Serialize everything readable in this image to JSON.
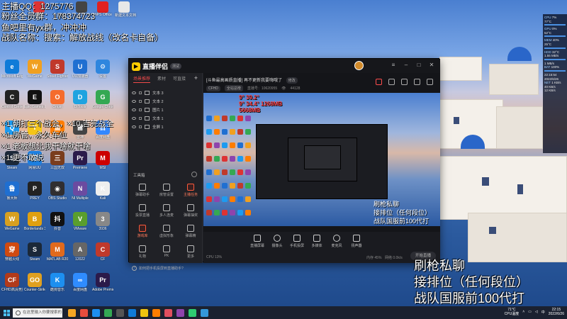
{
  "overlay_top": {
    "line1": "主播QQ：1275776",
    "line2": "粉丝全员群：178374723",
    "line3": "鱼吧里有yx群，冲冲冲",
    "line4": "战队名称：搜索：解放战线（改名卡自备）"
  },
  "overlay_mid": {
    "line1": "×1 朝打三个战会，×10 吉完战全",
    "line2": "×1 房管，永久车位",
    "line3": "×1 老板想让我干啥就干啥",
    "line4": "×1 更不敢说"
  },
  "overlay_bottom": {
    "line1": "刷枪私聊",
    "line2": "接排位（任何段位）",
    "line3": "战队国服前100代打"
  },
  "desktop_top_icons": [
    {
      "label": "网易云",
      "color": "#d33"
    },
    {
      "label": "迅雷",
      "color": "#3a7bd5"
    },
    {
      "label": "CF",
      "color": "#444"
    },
    {
      "label": "WPS Office",
      "color": "#e02020"
    },
    {
      "label": "新建文本文档",
      "color": "#e8e8e8"
    }
  ],
  "desktop_icons": [
    {
      "label": "Microsoft Edge",
      "glyph": "e",
      "color": "#0f7bd8"
    },
    {
      "label": "WeGame",
      "glyph": "W",
      "color": "#f0a020"
    },
    {
      "label": "Street Fighter",
      "glyph": "S",
      "color": "#c0392b"
    },
    {
      "label": "UU加速器",
      "glyph": "U",
      "color": "#1f6fd1"
    },
    {
      "label": "设置",
      "glyph": "⚙",
      "color": "#2e86de"
    },
    {
      "label": "Control Center 3.0",
      "glyph": "C",
      "color": "#222"
    },
    {
      "label": "Epic Games Launcher",
      "glyph": "E",
      "color": "#111"
    },
    {
      "label": "Origin",
      "glyph": "O",
      "color": "#f56c2d"
    },
    {
      "label": "DiTools",
      "glyph": "D",
      "color": "#1fa3e0"
    },
    {
      "label": "Google Chrome",
      "glyph": "G",
      "color": "#34a853"
    },
    {
      "label": "腾讯QQ",
      "glyph": "Q",
      "color": "#1d9bf0"
    },
    {
      "label": "YY语音",
      "glyph": "Y",
      "color": "#f5c518"
    },
    {
      "label": "斗鱼",
      "glyph": "鱼",
      "color": "#ff7d00"
    },
    {
      "label": "雷神",
      "glyph": "雷",
      "color": "#444"
    },
    {
      "label": "百度网盘",
      "glyph": "百",
      "color": "#3388ff"
    },
    {
      "label": "Steam",
      "glyph": "S",
      "color": "#1b2838"
    },
    {
      "label": "网易UU",
      "glyph": "网",
      "color": "#1c7fe0"
    },
    {
      "label": "三国无双",
      "glyph": "三",
      "color": "#7a3d1d"
    },
    {
      "label": "Premiere",
      "glyph": "Pr",
      "color": "#2b1a4a"
    },
    {
      "label": "MSI",
      "glyph": "M",
      "color": "#c00"
    },
    {
      "label": "鲁大师",
      "glyph": "鲁",
      "color": "#1f6fd1"
    },
    {
      "label": "PREY",
      "glyph": "P",
      "color": "#222"
    },
    {
      "label": "OBS Studio",
      "glyph": "◉",
      "color": "#302e31"
    },
    {
      "label": "NI Multiple",
      "glyph": "N",
      "color": "#6b4ba0"
    },
    {
      "label": "Kali",
      "glyph": "K",
      "color": "#eee"
    },
    {
      "label": "WeGame",
      "glyph": "W",
      "color": "#d8a020"
    },
    {
      "label": "Borderlands 3",
      "glyph": "B",
      "color": "#e0a010"
    },
    {
      "label": "抖音",
      "glyph": "抖",
      "color": "#111"
    },
    {
      "label": "VMware",
      "glyph": "V",
      "color": "#5a9e2d"
    },
    {
      "label": "3936",
      "glyph": "3",
      "color": "#888"
    },
    {
      "label": "穿越火线",
      "glyph": "穿",
      "color": "#d04a10"
    },
    {
      "label": "Steam",
      "glyph": "S",
      "color": "#1b2838"
    },
    {
      "label": "MATLAB R2022a",
      "glyph": "M",
      "color": "#e06a1d"
    },
    {
      "label": "12022",
      "glyph": "A",
      "color": "#666"
    },
    {
      "label": "CF",
      "glyph": "C",
      "color": "#c0392b"
    },
    {
      "label": "CFHD高清竞技大区",
      "glyph": "CF",
      "color": "#b23a1a"
    },
    {
      "label": "Counter-Strike Global Off",
      "glyph": "GO",
      "color": "#e0a020"
    },
    {
      "label": "酷狗音乐",
      "glyph": "K",
      "color": "#1d8ff0"
    },
    {
      "label": "百度网盘",
      "glyph": "∞",
      "color": "#2f8cff"
    },
    {
      "label": "Adobe Premiere",
      "glyph": "Pr",
      "color": "#2b1a4a"
    }
  ],
  "app": {
    "name": "直播伴侣",
    "version_badge": "测试",
    "side_tabs": [
      "场景推荐",
      "素材",
      "可直接"
    ],
    "scenes": [
      "文本 3",
      "文本 2",
      "图片 1",
      "文本 1",
      "全屏 1"
    ],
    "tools_title": "工具箱",
    "tools": [
      {
        "label": "弹幕助手",
        "hot": false
      },
      {
        "label": "房管设置",
        "hot": false
      },
      {
        "label": "主播任务",
        "hot": true
      },
      {
        "label": "投票直播",
        "hot": false
      },
      {
        "label": "多人连麦",
        "hot": false
      },
      {
        "label": "弹幕抽奖",
        "hot": false
      },
      {
        "label": "游戏库",
        "hot": true
      },
      {
        "label": "虚拟形象",
        "hot": false
      },
      {
        "label": "弹幕精",
        "hot": false
      },
      {
        "label": "礼物",
        "hot": false
      },
      {
        "label": "PK",
        "hot": false
      },
      {
        "label": "更多",
        "hot": false
      }
    ],
    "footer": "如何把手机投屏到直播助手?",
    "stream_title": "[斗鱼最高画质直播] 再不更新我要嗨哦了",
    "edit_label": "修改",
    "meta": {
      "chip1": "CFHD",
      "chip2": "全站总榜",
      "meta_text": "直播号：10620955",
      "viewers": "44128"
    },
    "controls": [
      "直播屏幕",
      "摄像头",
      "手机投屏",
      "多媒体",
      "麦克风",
      "扬声器"
    ],
    "status_small": [
      "CPU 13%",
      "内存 45%",
      "网络 0.0k/s"
    ],
    "start_label": "开始直播",
    "preview_stats": [
      "9°  39.2°",
      "9°  34.4°  1268MB",
      "5668MB"
    ]
  },
  "hwmon": [
    {
      "k": "CPU",
      "v": "7%"
    },
    {
      "k": "",
      "v": "77°C"
    },
    {
      "k": "GPU",
      "v": "0%"
    },
    {
      "k": "",
      "v": "52°C"
    },
    {
      "k": "MEM",
      "v": "40%"
    },
    {
      "k": "",
      "v": "25°C"
    },
    {
      "k": "HDD",
      "v": "32°C"
    },
    {
      "k": "",
      "v": "1.55 MB/s"
    },
    {
      "k": "",
      "v": "1 MB/s"
    },
    {
      "k": "BAT",
      "v": "100%"
    },
    {
      "k": "",
      "v": "22:15:54"
    },
    {
      "k": "",
      "v": "2022/6/26"
    },
    {
      "k": "NET",
      "v": "1 KB/s"
    },
    {
      "k": "",
      "v": "40 KB/s"
    },
    {
      "k": "",
      "v": "12 KB/s"
    }
  ],
  "taskbar": {
    "search_placeholder": "在这里输入你要搜索的内容",
    "apps": [
      "#f5a623",
      "#e74c3c",
      "#1d8ff0",
      "#34a853",
      "#555",
      "#0f7bd8",
      "#f1c40f",
      "#ff7d00",
      "#e04f5f",
      "#8e44ad",
      "#2ecc71",
      "#3498db"
    ],
    "temp_label": "71°C",
    "temp_sub": "CPU温度",
    "lang": "中",
    "time": "22:15",
    "date": "2022/6/26"
  }
}
